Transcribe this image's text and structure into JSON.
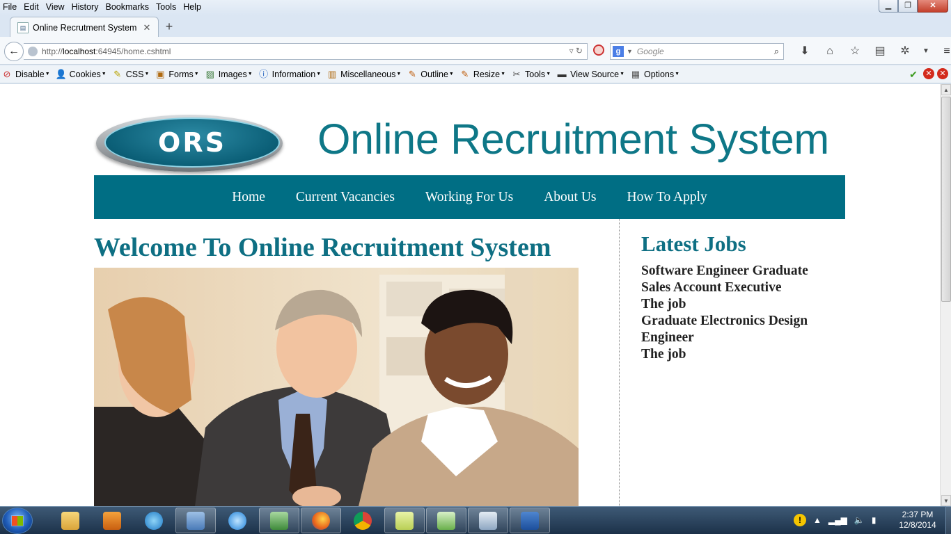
{
  "browser": {
    "menu": [
      "File",
      "Edit",
      "View",
      "History",
      "Bookmarks",
      "Tools",
      "Help"
    ],
    "tab_title": "Online Recrutment System",
    "url_prefix": "http://",
    "url_host": "localhost",
    "url_rest": ":64945/home.cshtml",
    "search_placeholder": "Google",
    "search_engine_letter": "g"
  },
  "devbar": {
    "items": [
      "Disable",
      "Cookies",
      "CSS",
      "Forms",
      "Images",
      "Information",
      "Miscellaneous",
      "Outline",
      "Resize",
      "Tools",
      "View Source",
      "Options"
    ]
  },
  "site": {
    "logo_text": "ORS",
    "title": "Online Recruitment System",
    "nav": [
      "Home",
      "Current Vacancies",
      "Working For Us",
      "About Us",
      "How To Apply"
    ],
    "welcome": "Welcome To Online Recruitment System",
    "latest_title": "Latest Jobs",
    "jobs": [
      "Software Engineer Graduate",
      "Sales Account Executive",
      "The job",
      "Graduate Electronics Design Engineer",
      "The job"
    ]
  },
  "taskbar": {
    "time": "2:37 PM",
    "date": "12/8/2014"
  },
  "colors": {
    "brand_teal": "#006e84",
    "heading_teal": "#0e6f83"
  }
}
